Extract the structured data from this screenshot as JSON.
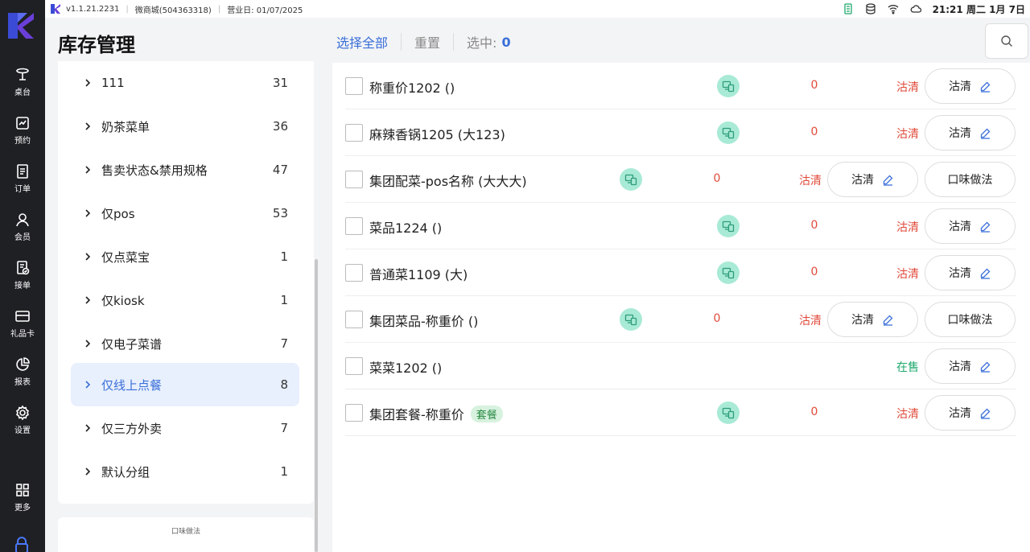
{
  "statusbar": {
    "version": "v1.1.21.2231",
    "store": "微商城(504363318)",
    "business_day": "营业日: 01/07/2025",
    "clock": "21:21 周二 1月 7日"
  },
  "nav": {
    "items": [
      {
        "label": "桌台",
        "icon": "table-icon"
      },
      {
        "label": "预约",
        "icon": "reservation-icon"
      },
      {
        "label": "订单",
        "icon": "order-icon"
      },
      {
        "label": "会员",
        "icon": "member-icon"
      },
      {
        "label": "接单",
        "icon": "accept-order-icon"
      },
      {
        "label": "礼品卡",
        "icon": "gift-card-icon"
      },
      {
        "label": "报表",
        "icon": "report-icon"
      },
      {
        "label": "设置",
        "icon": "settings-icon"
      },
      {
        "label": "更多",
        "icon": "more-icon"
      }
    ]
  },
  "header": {
    "title": "库存管理",
    "select_all": "选择全部",
    "reset": "重置",
    "selected_label": "选中:",
    "selected_count": "0"
  },
  "categories": [
    {
      "name": "111",
      "count": "31"
    },
    {
      "name": "奶茶菜单",
      "count": "36"
    },
    {
      "name": "售卖状态&禁用规格",
      "count": "47"
    },
    {
      "name": "仅pos",
      "count": "53"
    },
    {
      "name": "仅点菜宝",
      "count": "1"
    },
    {
      "name": "仅kiosk",
      "count": "1"
    },
    {
      "name": "仅电子菜谱",
      "count": "7"
    },
    {
      "name": "仅线上点餐",
      "count": "8",
      "active": true
    },
    {
      "name": "仅三方外卖",
      "count": "7"
    },
    {
      "name": "默认分组",
      "count": "1"
    }
  ],
  "bottom_panel": {
    "label": "口味做法"
  },
  "products": [
    {
      "name": "称重价1202 ()",
      "stock": "0",
      "status": "沽清",
      "action": "沽清"
    },
    {
      "name": "麻辣香锅1205 (大123)",
      "stock": "0",
      "status": "沽清",
      "action": "沽清"
    },
    {
      "name": "集团配菜-pos名称 (大大大)",
      "stock": "0",
      "status": "沽清",
      "action": "沽清",
      "extra": "口味做法"
    },
    {
      "name": "菜品1224 ()",
      "stock": "0",
      "status": "沽清",
      "action": "沽清"
    },
    {
      "name": "普通菜1109 (大)",
      "stock": "0",
      "status": "沽清",
      "action": "沽清"
    },
    {
      "name": "集团菜品-称重价 ()",
      "stock": "0",
      "status": "沽清",
      "action": "沽清",
      "extra": "口味做法"
    },
    {
      "name": "菜菜1202 ()",
      "status": "在售",
      "action": "沽清"
    },
    {
      "name": "集团套餐-称重价",
      "tag": "套餐",
      "stock": "0",
      "status": "沽清",
      "action": "沽清"
    }
  ],
  "colors": {
    "accent": "#3a6fd8",
    "danger": "#e04a3a",
    "success": "#1da86b",
    "nav_bg": "#1f2024"
  }
}
